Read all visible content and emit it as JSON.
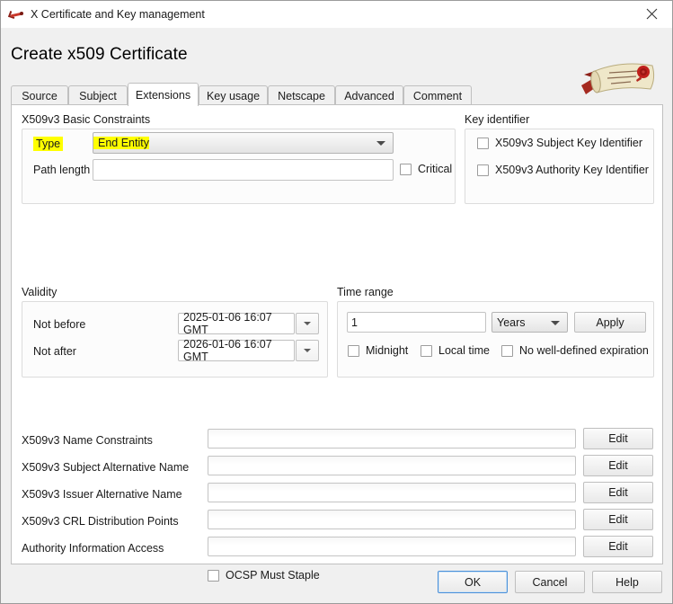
{
  "titlebar": {
    "icon": "xca-scroll-icon",
    "title": "X Certificate and Key management",
    "close_icon": "close-icon"
  },
  "heading": "Create x509 Certificate",
  "logo": {
    "name": "xca-logo",
    "ribbon_color": "#8d2018",
    "scroll_color": "#efe6c8",
    "seal_color": "#c0201c"
  },
  "tabs": [
    {
      "label": "Source",
      "active": false
    },
    {
      "label": "Subject",
      "active": false
    },
    {
      "label": "Extensions",
      "active": true
    },
    {
      "label": "Key usage",
      "active": false
    },
    {
      "label": "Netscape",
      "active": false
    },
    {
      "label": "Advanced",
      "active": false
    },
    {
      "label": "Comment",
      "active": false
    }
  ],
  "basic_constraints": {
    "group_title": "X509v3 Basic Constraints",
    "type_label": "Type",
    "type_value": "End Entity",
    "type_highlight_color": "#ffff00",
    "path_length_label": "Path length",
    "path_length_value": "",
    "critical_label": "Critical",
    "critical_checked": false
  },
  "key_identifier": {
    "group_title": "Key identifier",
    "subject_key_identifier_label": "X509v3 Subject Key Identifier",
    "subject_key_identifier_checked": false,
    "authority_key_identifier_label": "X509v3 Authority Key Identifier",
    "authority_key_identifier_checked": false
  },
  "validity": {
    "group_title": "Validity",
    "not_before_label": "Not before",
    "not_before_value": "2025-01-06 16:07 GMT",
    "not_after_label": "Not after",
    "not_after_value": "2026-01-06 16:07 GMT"
  },
  "time_range": {
    "group_title": "Time range",
    "amount_value": "1",
    "unit_value": "Years",
    "apply_label": "Apply",
    "midnight_label": "Midnight",
    "midnight_checked": false,
    "local_time_label": "Local time",
    "local_time_checked": false,
    "no_expiration_label": "No well-defined expiration",
    "no_expiration_checked": false
  },
  "extension_rows": [
    {
      "label": "X509v3 Name Constraints",
      "value": "",
      "button": "Edit"
    },
    {
      "label": "X509v3 Subject Alternative Name",
      "value": "",
      "button": "Edit"
    },
    {
      "label": "X509v3 Issuer Alternative Name",
      "value": "",
      "button": "Edit"
    },
    {
      "label": "X509v3 CRL Distribution Points",
      "value": "",
      "button": "Edit"
    },
    {
      "label": "Authority Information Access",
      "value": "",
      "button": "Edit"
    }
  ],
  "ocsp": {
    "label": "OCSP Must Staple",
    "checked": false
  },
  "dialog_buttons": {
    "ok": "OK",
    "cancel": "Cancel",
    "help": "Help"
  }
}
